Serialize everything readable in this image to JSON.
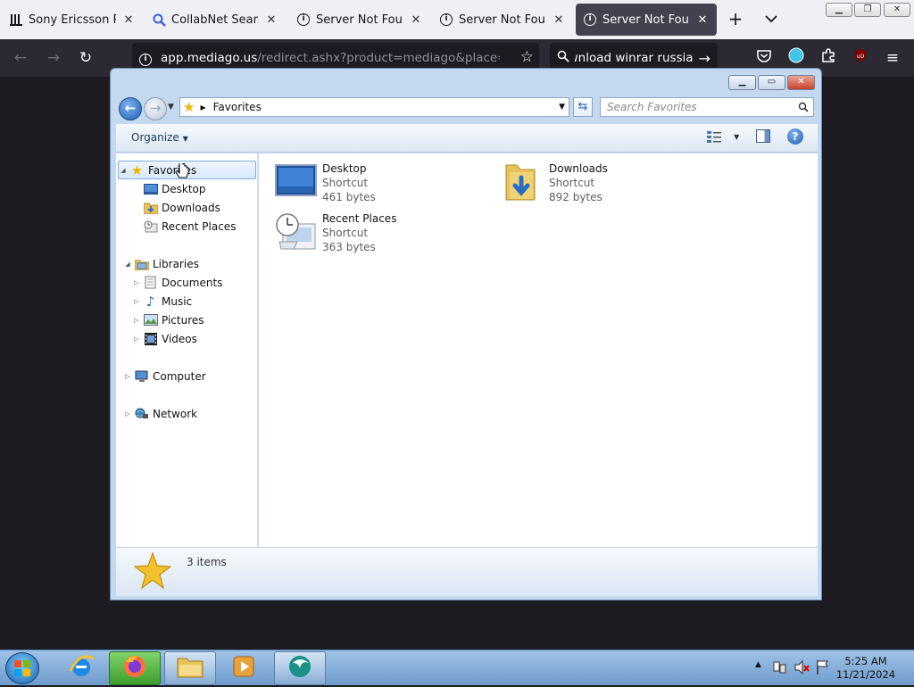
{
  "browser": {
    "tabs": [
      {
        "title": "Sony Ericsson PC Su",
        "icon": "library-icon",
        "active": false
      },
      {
        "title": "CollabNet SearXNG",
        "icon": "search-icon",
        "active": false
      },
      {
        "title": "Server Not Found",
        "icon": "info-icon",
        "active": false
      },
      {
        "title": "Server Not Found",
        "icon": "info-icon",
        "active": false
      },
      {
        "title": "Server Not Found",
        "icon": "info-icon",
        "active": true
      }
    ],
    "url_host": "app.mediago.us",
    "url_rest": "/redirect.ashx?product=mediago&place=help&v",
    "url_prefix": "",
    "search_query": "ownload winrar russia"
  },
  "explorer": {
    "address": "Favorites",
    "search_placeholder": "Search Favorites",
    "organize_label": "Organize",
    "tree": {
      "favorites": "Favorites",
      "desktop": "Desktop",
      "downloads": "Downloads",
      "recent_places": "Recent Places",
      "libraries": "Libraries",
      "documents": "Documents",
      "music": "Music",
      "pictures": "Pictures",
      "videos": "Videos",
      "computer": "Computer",
      "network": "Network"
    },
    "items": [
      {
        "name": "Desktop",
        "type": "Shortcut",
        "size": "461 bytes"
      },
      {
        "name": "Downloads",
        "type": "Shortcut",
        "size": "892 bytes"
      },
      {
        "name": "Recent Places",
        "type": "Shortcut",
        "size": "363 bytes"
      }
    ],
    "status": "3 items"
  },
  "taskbar": {
    "time": "5:25 AM",
    "date": "11/21/2024"
  },
  "colors": {
    "tab_active": "#42414d",
    "toolbar": "#2b2a33",
    "explorer_frame": "#c4d9ef",
    "selection": "#d8e8fa"
  }
}
